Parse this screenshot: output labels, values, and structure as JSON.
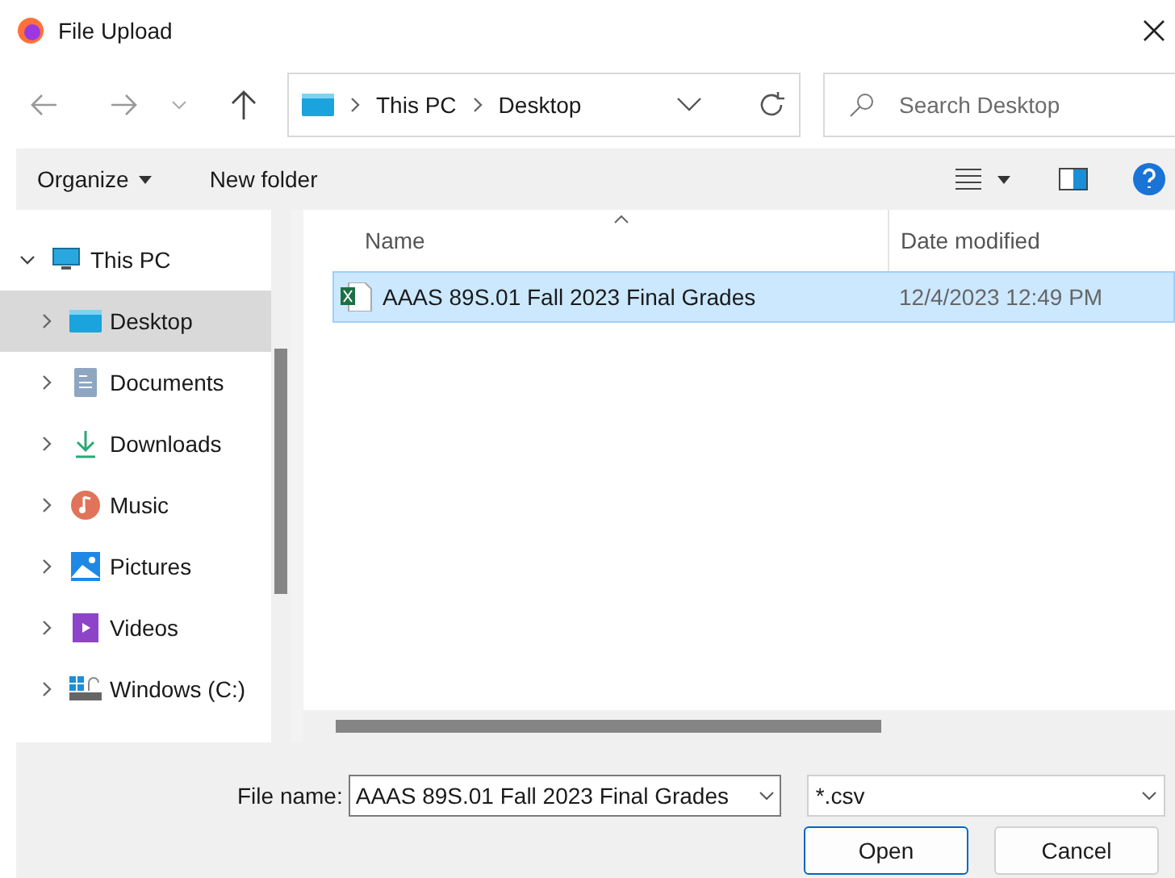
{
  "window": {
    "title": "File Upload"
  },
  "address_bar": {
    "path": [
      "This PC",
      "Desktop"
    ]
  },
  "search": {
    "placeholder": "Search Desktop"
  },
  "toolbar": {
    "organize": "Organize",
    "new_folder": "New folder"
  },
  "sidebar": {
    "items": [
      {
        "label": "This PC",
        "kind": "pc",
        "expanded": true,
        "selected": false,
        "children": [
          {
            "label": "Desktop",
            "kind": "desktop",
            "expanded": false,
            "selected": true
          },
          {
            "label": "Documents",
            "kind": "documents",
            "expanded": false,
            "selected": false
          },
          {
            "label": "Downloads",
            "kind": "downloads",
            "expanded": false,
            "selected": false
          },
          {
            "label": "Music",
            "kind": "music",
            "expanded": false,
            "selected": false
          },
          {
            "label": "Pictures",
            "kind": "pictures",
            "expanded": false,
            "selected": false
          },
          {
            "label": "Videos",
            "kind": "videos",
            "expanded": false,
            "selected": false
          },
          {
            "label": "Windows (C:)",
            "kind": "drive",
            "expanded": false,
            "selected": false
          }
        ]
      }
    ]
  },
  "table": {
    "columns": [
      "Name",
      "Date modified"
    ],
    "rows": [
      {
        "name": "AAAS 89S.01 Fall 2023 Final Grades",
        "date": "12/4/2023 12:49 PM",
        "selected": true
      }
    ]
  },
  "footer": {
    "file_name_label": "File name:",
    "file_name": "AAAS 89S.01 Fall 2023 Final Grades",
    "file_type": "*.csv",
    "buttons": [
      "Open",
      "Cancel"
    ]
  }
}
